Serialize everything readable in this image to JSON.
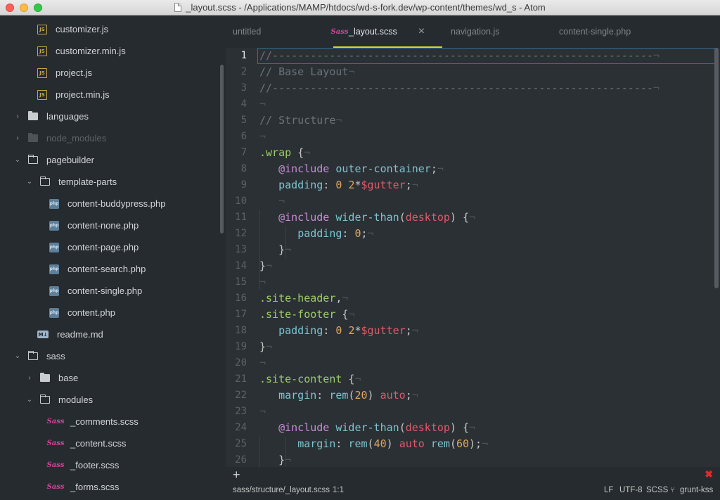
{
  "window": {
    "title": "_layout.scss - /Applications/MAMP/htdocs/wd-s-fork.dev/wp-content/themes/wd_s - Atom"
  },
  "tree": {
    "items": [
      {
        "label": "customizer.js",
        "type": "js"
      },
      {
        "label": "customizer.min.js",
        "type": "js"
      },
      {
        "label": "project.js",
        "type": "js"
      },
      {
        "label": "project.min.js",
        "type": "js"
      },
      {
        "label": "languages",
        "type": "folder-closed"
      },
      {
        "label": "node_modules",
        "type": "folder-dim"
      },
      {
        "label": "pagebuilder",
        "type": "folder-open"
      },
      {
        "label": "template-parts",
        "type": "folder-open"
      },
      {
        "label": "content-buddypress.php",
        "type": "php"
      },
      {
        "label": "content-none.php",
        "type": "php"
      },
      {
        "label": "content-page.php",
        "type": "php"
      },
      {
        "label": "content-search.php",
        "type": "php"
      },
      {
        "label": "content-single.php",
        "type": "php"
      },
      {
        "label": "content.php",
        "type": "php"
      },
      {
        "label": "readme.md",
        "type": "md"
      },
      {
        "label": "sass",
        "type": "folder-open"
      },
      {
        "label": "base",
        "type": "folder-closed"
      },
      {
        "label": "modules",
        "type": "folder-open"
      },
      {
        "label": "_comments.scss",
        "type": "sass"
      },
      {
        "label": "_content.scss",
        "type": "sass"
      },
      {
        "label": "_footer.scss",
        "type": "sass"
      },
      {
        "label": "_forms.scss",
        "type": "sass"
      }
    ],
    "icon_text": {
      "js": "JS",
      "php": "php",
      "md": "M↓",
      "sass": "Sass"
    }
  },
  "tabs": [
    {
      "label": "untitled"
    },
    {
      "label": "_layout.scss",
      "active": true
    },
    {
      "label": "navigation.js"
    },
    {
      "label": "content-single.php"
    }
  ],
  "editor": {
    "line_numbers": [
      "1",
      "2",
      "3",
      "4",
      "5",
      "6",
      "7",
      "8",
      "9",
      "10",
      "11",
      "12",
      "13",
      "14",
      "15",
      "16",
      "17",
      "18",
      "19",
      "20",
      "21",
      "22",
      "23",
      "24",
      "25",
      "26"
    ],
    "current_line": "1"
  },
  "status": {
    "path": "sass/structure/_layout.scss",
    "cursor": "1:1",
    "line_ending": "LF",
    "encoding": "UTF-8",
    "grammar": "SCSS",
    "branch": "grunt-kss"
  },
  "panel": {
    "add": "+",
    "error": "✖"
  },
  "colors": {
    "accent_tab": "#d9d62a",
    "selector": "#9ccc6a",
    "keyword": "#c98cd6",
    "number": "#e0a75c",
    "variable": "#e05a6a"
  }
}
